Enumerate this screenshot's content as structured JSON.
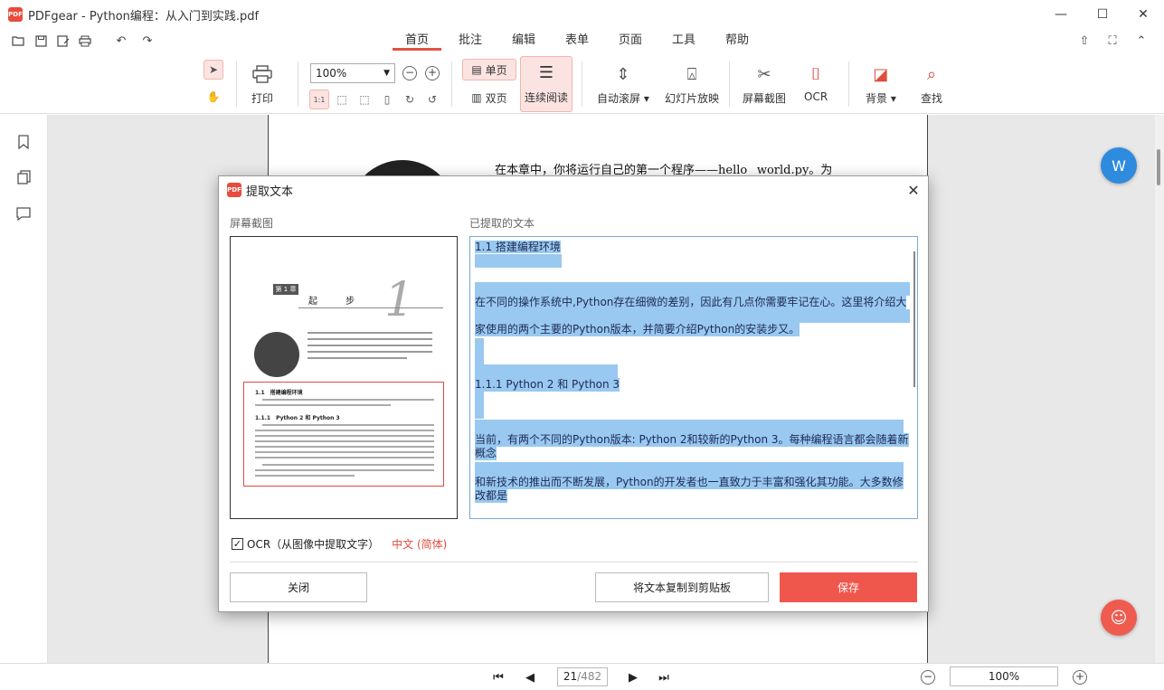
{
  "app": {
    "title": "PDFgear - Python编程：从入门到实践.pdf",
    "logo_text": "PDF",
    "accent_color": "#e94b3c"
  },
  "window_controls": {
    "minimize": "—",
    "maximize": "☐",
    "close": "✕"
  },
  "menu_tabs": [
    "首页",
    "批注",
    "编辑",
    "表单",
    "页面",
    "工具",
    "帮助"
  ],
  "menu_active": "首页",
  "ribbon": {
    "print_label": "打印",
    "zoom_value": "100%",
    "single_page_label": "单页",
    "double_page_label": "双页",
    "continuous_label": "连续阅读",
    "auto_scroll_label": "自动滚屏",
    "slideshow_label": "幻灯片放映",
    "screenshot_label": "屏幕截图",
    "ocr_label": "OCR",
    "background_label": "背景",
    "find_label": "查找"
  },
  "document": {
    "visible_line": "在本章中，你将运行自己的第一个程序——hello_ world.py。为"
  },
  "statusbar": {
    "current_page": "21",
    "total_pages": "/482",
    "zoom": "100%"
  },
  "dialog": {
    "title": "提取文本",
    "screenshot_label": "屏幕截图",
    "extracted_label": "已提取的文本",
    "extracted_lines": [
      "1.1 搭建编程环境",
      "在不同的操作系统中,Python存在细微的差别，因此有几点你需要牢记在心。这里将介绍大",
      "家使用的两个主要的Python版本，并简要介绍Python的安装步又。",
      "1.1.1 Python 2 和 Python 3",
      "当前，有两个不同的Python版本: Python 2和较新的Python 3。每种编程语言都会随着新",
      "概念",
      "和新技术的推出而不断发展，Python的开发者也一直致力于丰富和强化其功能。大多数修",
      "改都是"
    ],
    "ocr_checked": true,
    "ocr_label": "OCR（从图像中提取文字）",
    "ocr_language": "中文 (简体)",
    "close_button": "关闭",
    "copy_button": "将文本复制到剪贴板",
    "save_button": "保存",
    "mini_page": {
      "chapter_tag": "第 1 章",
      "chapter_title": "起 步",
      "chapter_number": "1",
      "section_1": "1.1　搭建编程环境",
      "section_2": "1.1.1　Python 2 和 Python 3"
    }
  }
}
